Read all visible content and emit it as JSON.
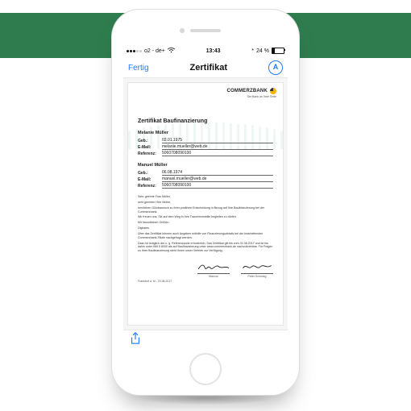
{
  "status": {
    "carrier": "o2 - de+",
    "time": "13:43",
    "battery_pct": "24 %",
    "bt_icon": "*"
  },
  "nav": {
    "done": "Fertig",
    "title": "Zertifikat",
    "aa": "A"
  },
  "brand": {
    "name": "COMMERZBANK",
    "tagline": "Die Bank an Ihrer Seite"
  },
  "doc": {
    "title": "Zertifikat Baufinanzierung",
    "people": [
      {
        "name": "Melanie Müller",
        "rows": [
          {
            "k": "Geb.:",
            "v": "02.01.1975"
          },
          {
            "k": "E-Mail:",
            "v": "melanie.mueller@web.de"
          },
          {
            "k": "Referenz:",
            "v": "5060708090100"
          }
        ]
      },
      {
        "name": "Manuel Müller",
        "rows": [
          {
            "k": "Geb.:",
            "v": "06.08.1974"
          },
          {
            "k": "E-Mail:",
            "v": "manuel.mueller@web.de"
          },
          {
            "k": "Referenz:",
            "v": "5060708090100"
          }
        ]
      }
    ],
    "body": [
      "Sehr geehrte Frau Müller,",
      "sehr geehrter Herr Müller,",
      "herzlichen Glückwunsch zu Ihrer positiven Entscheidung in Bezug auf Ihre Baufinanzierung bei der Commerzbank.",
      "Wir freuen uns, Sie auf dem Weg in Ihre Traumimmobilie begleiten zu dürfen.",
      "Mit freundlichen Grüßen",
      "Digitales",
      "Über das Zertifikat können auch Angaben mithilfe von Finanzierungsdetails bei der bearbeitenden Commerzbank-Filiale nachgefragt werden.",
      "Dazu ist lediglich der o. g. Referenzcode erforderlich. Das Zertifikat gilt bis zum 31.08.2017 und ist bis dahin unter 069 5 8000 als auf Baufinanzierung unter www.commerzbank.de nachvollziehbar. Für Fragen zu Ihrer Baufinanzierung steht Ihnen unser Vertrieb zur Verfügung."
    ],
    "footer_date": "Frankfurt a. M., 23.08.2017",
    "sig1": "Marcus",
    "sig2": "Peter Schmieg"
  }
}
